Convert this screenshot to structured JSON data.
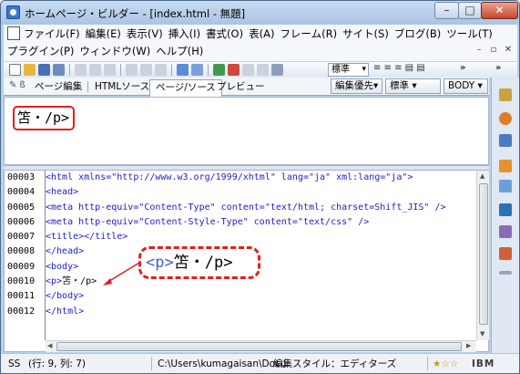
{
  "window": {
    "title": "ホームページ・ビルダー - [index.html - 無題]",
    "minimize": "–",
    "maximize": "□",
    "close": "✕"
  },
  "menus": {
    "row1": [
      "ファイル(F)",
      "編集(E)",
      "表示(V)",
      "挿入(I)",
      "書式(O)",
      "表(A)",
      "フレーム(R)",
      "サイト(S)",
      "ブログ(B)",
      "ツール(T)"
    ],
    "row2": [
      "プラグイン(P)",
      "ウィンドウ(W)",
      "ヘルプ(H)"
    ]
  },
  "toolbar": {
    "style_dropdown": "標準",
    "overflow": "»"
  },
  "tabs": {
    "labels": [
      "ページ編集",
      "HTMLソース",
      "ページ/ソース",
      "プレビュー"
    ],
    "selected_index": 2,
    "edit_priority": "編集優先▾",
    "style_select": "標準",
    "element_select": "BODY"
  },
  "preview": {
    "content": "笘・/p>"
  },
  "source": {
    "lines": [
      {
        "num": "00003",
        "text": "<html xmlns=\"http://www.w3.org/1999/xhtml\" lang=\"ja\" xml:lang=\"ja\">"
      },
      {
        "num": "00004",
        "text": "<head>"
      },
      {
        "num": "00005",
        "text": "<meta http-equiv=\"Content-Type\" content=\"text/html; charset=Shift_JIS\" />"
      },
      {
        "num": "00006",
        "text": "<meta http-equiv=\"Content-Style-Type\" content=\"text/css\" />"
      },
      {
        "num": "00007",
        "text": "<title></title>"
      },
      {
        "num": "00008",
        "text": "</head>"
      },
      {
        "num": "00009",
        "text": "<body>"
      },
      {
        "num": "00010",
        "text": "<p>笘・/p>"
      },
      {
        "num": "00011",
        "text": "</body>"
      },
      {
        "num": "00012",
        "text": "</html>"
      }
    ]
  },
  "callout": {
    "tag": "<p>",
    "text": "笘・/p>"
  },
  "statusbar": {
    "mode": "SS",
    "position": "(行: 9, 列: 7)",
    "path": "C:\\Users\\kumagaisan\\Docu",
    "edit_style": "編集スタイル：エディターズ",
    "rating": "★☆☆",
    "vendor": "IBM"
  },
  "colors": {
    "annotation": "#e02020",
    "tag": "#2020c8"
  }
}
